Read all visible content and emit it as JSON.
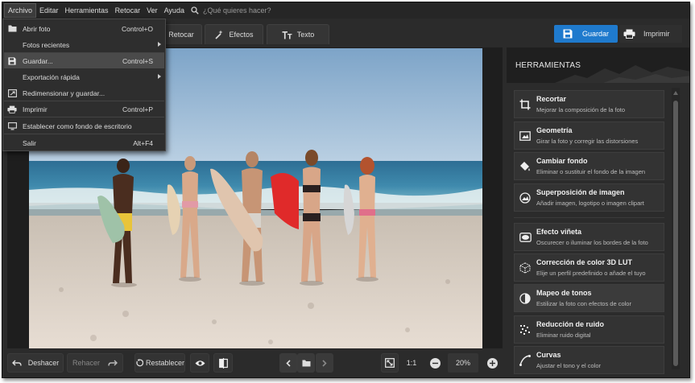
{
  "menubar": {
    "items": [
      "Archivo",
      "Editar",
      "Herramientas",
      "Retocar",
      "Ver",
      "Ayuda"
    ],
    "search_placeholder": "¿Qué quieres hacer?"
  },
  "tabs": [
    "Retocar",
    "Efectos",
    "Texto"
  ],
  "toolbar": {
    "save_label": "Guardar",
    "print_label": "Imprimir"
  },
  "file_menu": [
    {
      "label": "Abrir foto",
      "shortcut": "Control+O",
      "icon": "folder-icon"
    },
    {
      "label": "Fotos recientes",
      "submenu": true
    },
    {
      "label": "Guardar...",
      "shortcut": "Control+S",
      "icon": "save-icon",
      "highlighted": true
    },
    {
      "label": "Exportación rápida",
      "submenu": true
    },
    {
      "label": "Redimensionar y guardar...",
      "icon": "resize-icon"
    },
    {
      "label": "Imprimir",
      "shortcut": "Control+P",
      "icon": "printer-icon"
    },
    {
      "label": "Establecer como fondo de escritorio",
      "icon": "monitor-icon"
    },
    {
      "label": "Salir",
      "shortcut": "Alt+F4"
    }
  ],
  "panel": {
    "title": "HERRAMIENTAS",
    "tools": [
      {
        "title": "Recortar",
        "desc": "Mejorar la composición de la foto",
        "icon": "crop-icon"
      },
      {
        "title": "Geometría",
        "desc": "Girar la foto y corregir las distorsiones",
        "icon": "geometry-icon"
      },
      {
        "title": "Cambiar fondo",
        "desc": "Eliminar o sustituir el fondo de la imagen",
        "icon": "fill-bucket-icon"
      },
      {
        "title": "Superposición de imagen",
        "desc": "Añadir imagen, logotipo o imagen clipart",
        "icon": "image-overlay-icon"
      },
      {
        "title": "Efecto viñeta",
        "desc": "Oscurecer o iluminar los bordes de la foto",
        "icon": "vignette-icon"
      },
      {
        "title": "Corrección de color 3D LUT",
        "desc": "Elije un perfil predefinido o añade el tuyo",
        "icon": "lut-cube-icon"
      },
      {
        "title": "Mapeo de tonos",
        "desc": "Estilizar la foto con efectos de color",
        "icon": "tone-mapping-icon"
      },
      {
        "title": "Reducción de ruido",
        "desc": "Eliminar ruido digital",
        "icon": "noise-icon"
      },
      {
        "title": "Curvas",
        "desc": "Ajustar el tono y el color",
        "icon": "curves-icon"
      }
    ]
  },
  "bottombar": {
    "undo_label": "Deshacer",
    "redo_label": "Rehacer",
    "reset_label": "Restablecer",
    "zoom_one": "1:1",
    "zoom_value": "20%"
  },
  "colors": {
    "accent": "#1f7acd",
    "background": "#2b2b2b",
    "panel_header": "#1f1f1f"
  }
}
